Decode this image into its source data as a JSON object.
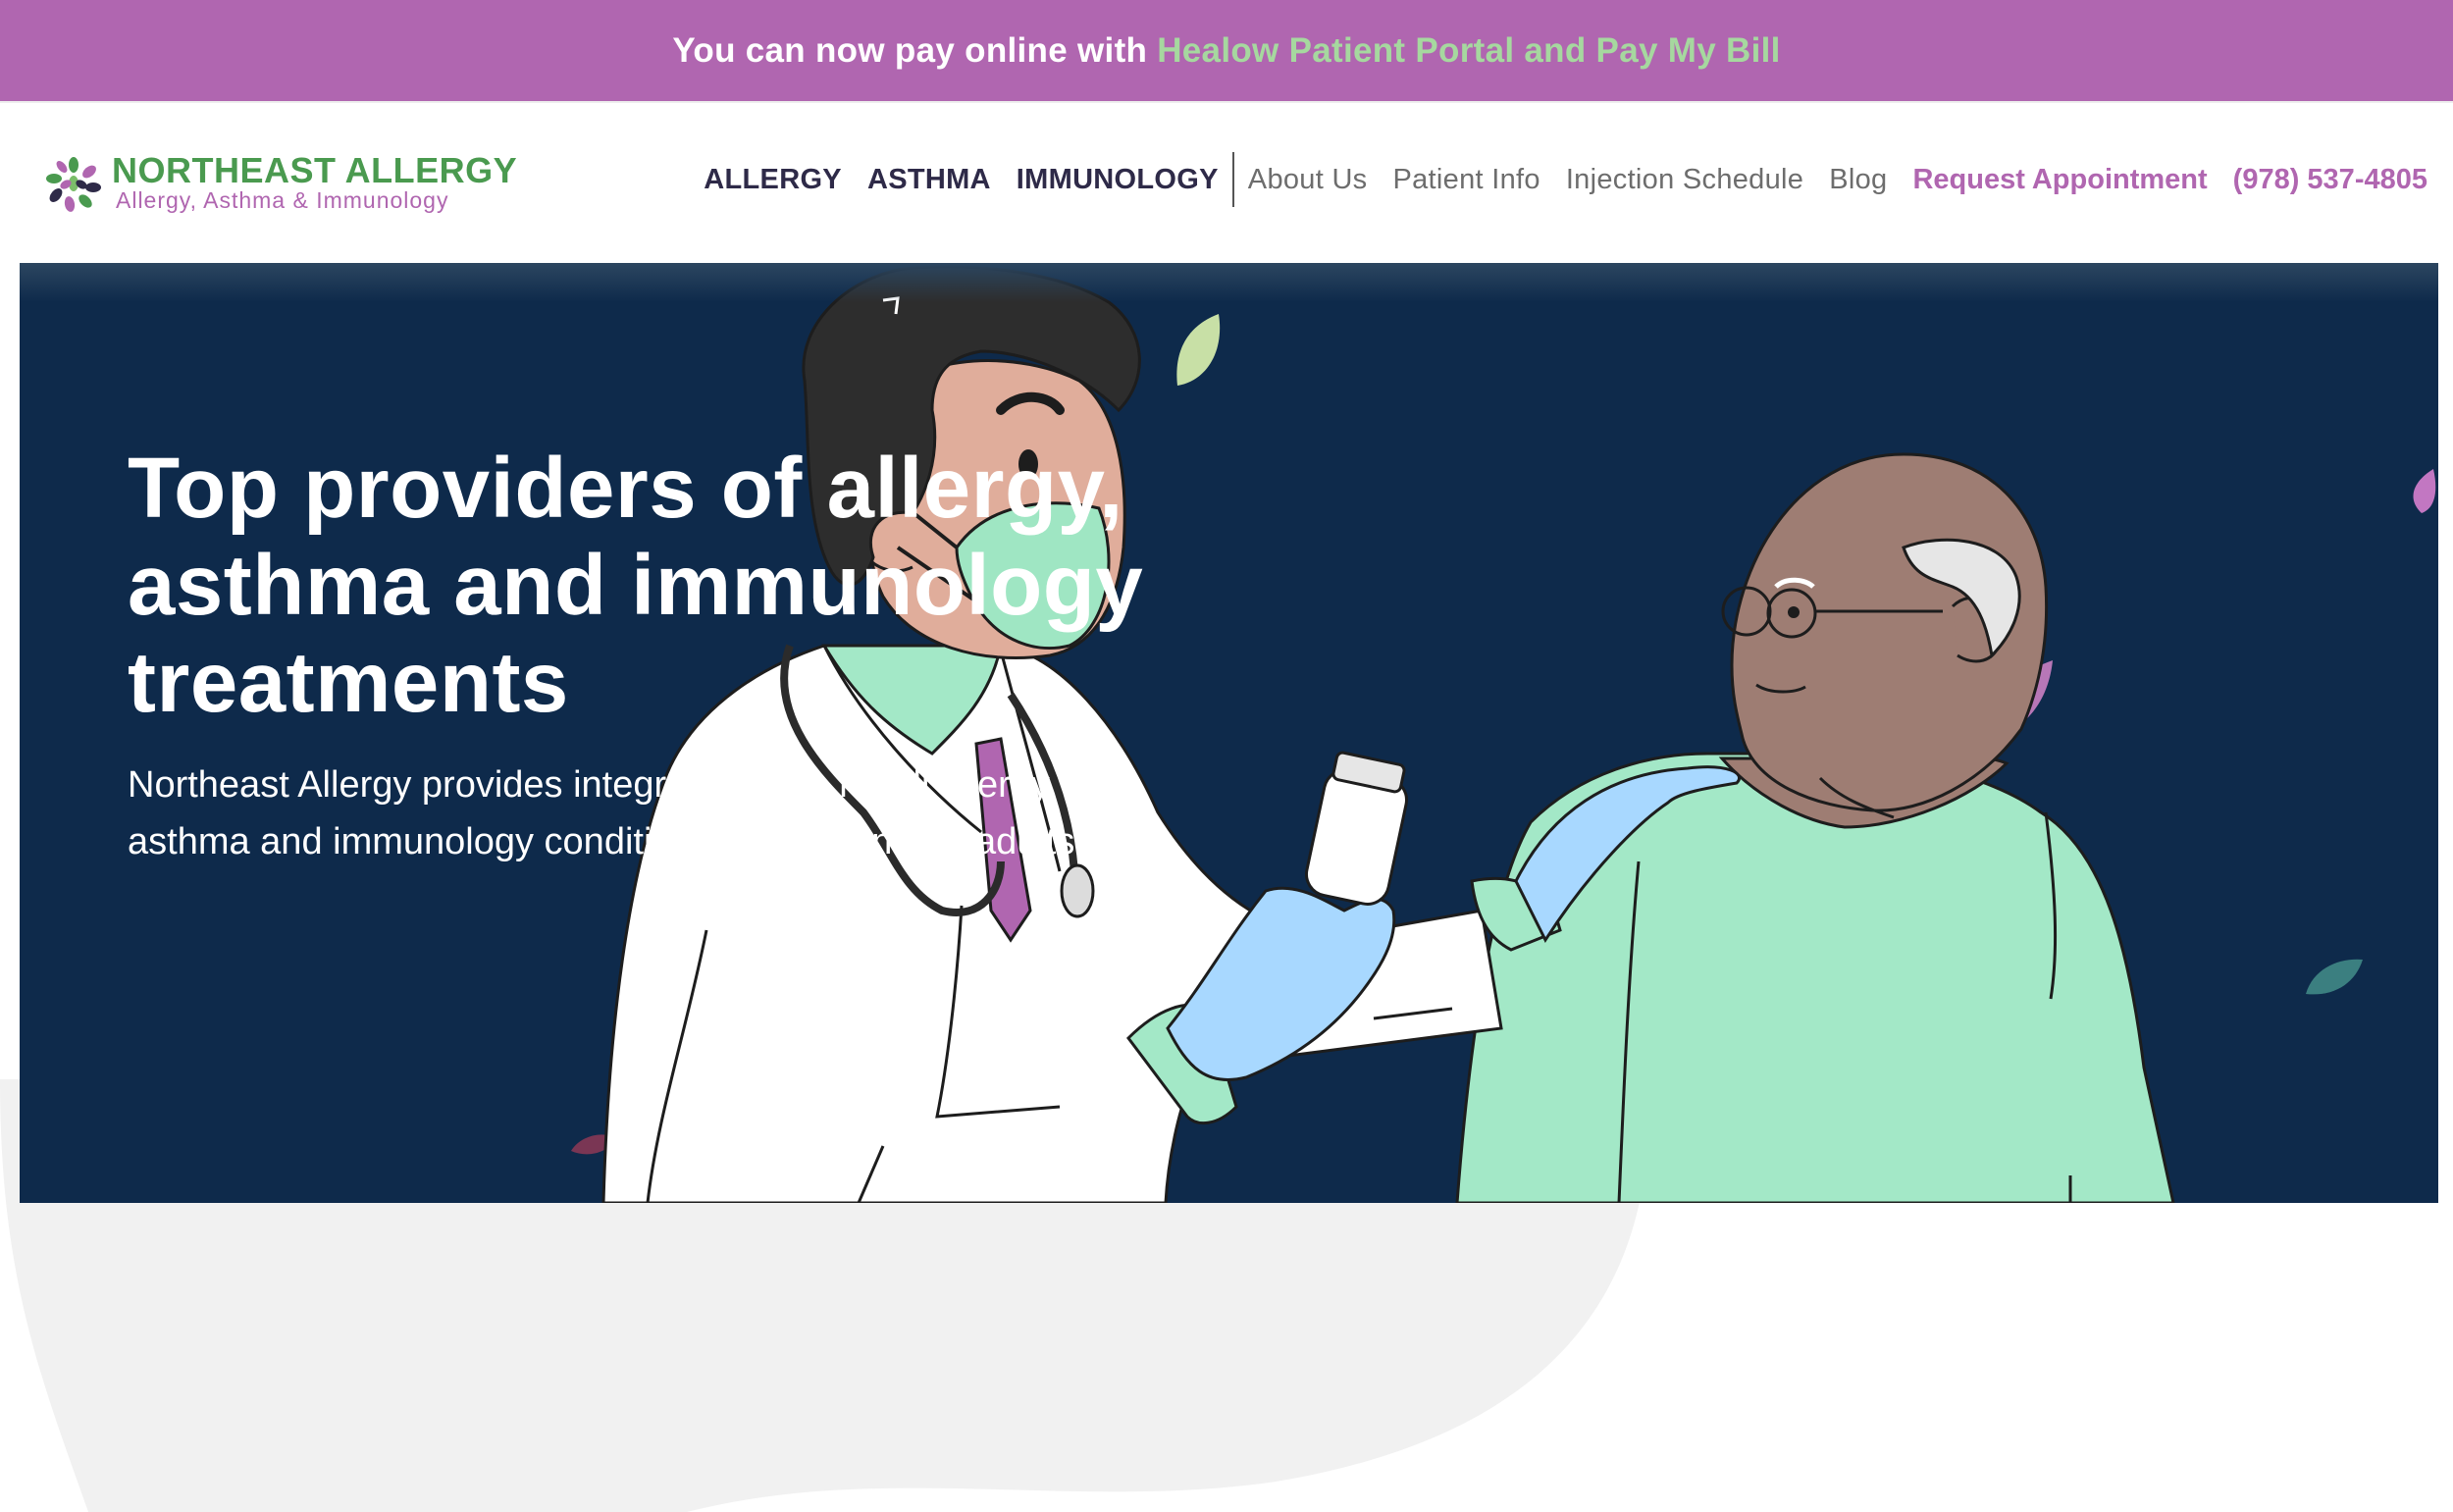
{
  "banner": {
    "text": "You can now pay online with",
    "link": "Healow Patient Portal and Pay My Bill"
  },
  "logo": {
    "title": "NORTHEAST ALLERGY",
    "subtitle": "Allergy, Asthma & Immunology"
  },
  "nav": {
    "main": [
      "ALLERGY",
      "ASTHMA",
      "IMMUNOLOGY"
    ],
    "secondary": [
      "About Us",
      "Patient Info",
      "Injection Schedule",
      "Blog"
    ],
    "cta": "Request Appointment",
    "phone": "(978) 537-4805"
  },
  "hero": {
    "title": "Top providers of allergy, asthma and immunology treatments",
    "description": "Northeast Allergy provides integrative care for all allergy, asthma and immunology conditions in children and adults."
  },
  "colors": {
    "brand_purple": "#b066b0",
    "brand_green": "#4a9a4f",
    "link_green": "#a6d89f",
    "hero_navy": "#0e2a4b",
    "nav_dark": "#2e2a48",
    "scrub_green": "#a3e8c7",
    "glove_blue": "#a8d8ff"
  }
}
